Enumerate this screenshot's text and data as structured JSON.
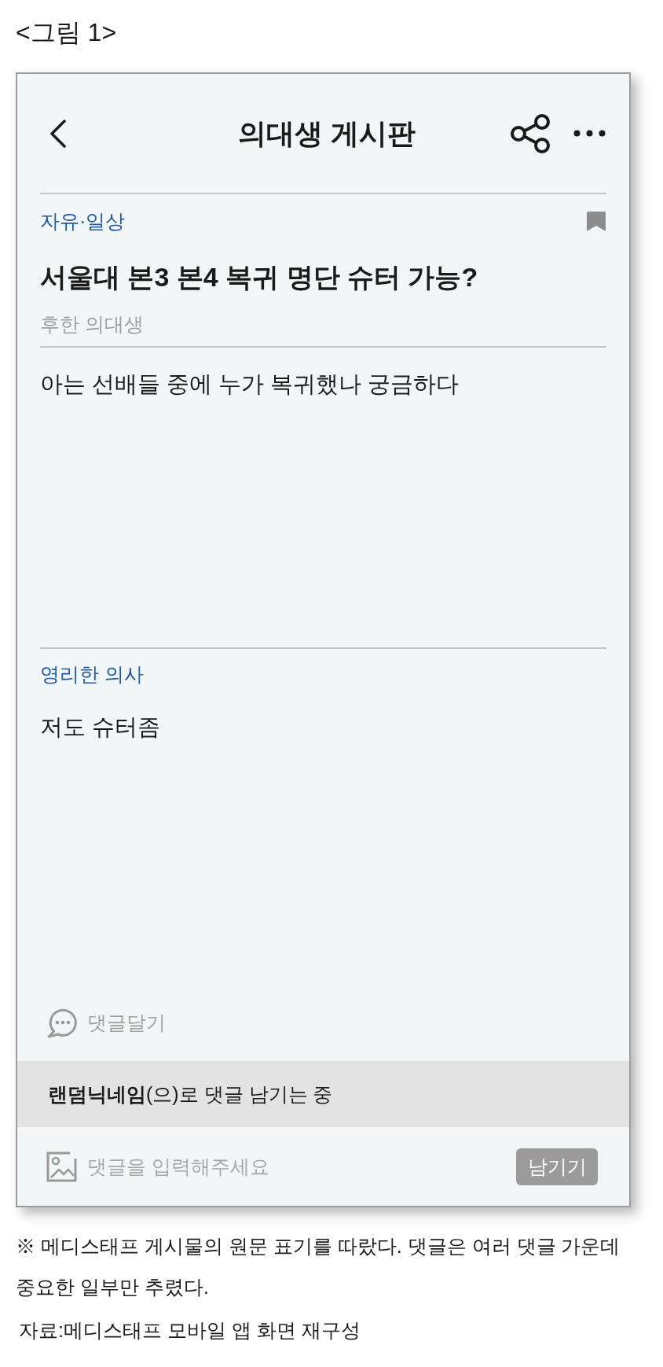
{
  "figure_label": "<그림 1>",
  "app": {
    "header": {
      "title": "의대생 게시판"
    },
    "post": {
      "category": "자유·일상",
      "title": "서울대 본3 본4 복귀 명단 슈터 가능?",
      "author": "후한 의대생",
      "body": "아는 선배들 중에 누가 복귀했나 궁금하다"
    },
    "comments": [
      {
        "author": "영리한 의사",
        "text": "저도 슈터좀"
      }
    ],
    "comment_button": {
      "label": "댓글달기"
    },
    "nickname_notice": "**랜덤닉네임**(으)로 댓글 남기는 중",
    "comment_input": {
      "placeholder": "댓글을 입력해주세요",
      "submit": {
        "label": "남기기",
        "disabled": true
      }
    }
  },
  "footnote": "※ 메디스태프 게시물의 원문 표기를 따랐다. 댓글은 여러 댓글 가운데 중요한 일부만 추렸다.",
  "source": "자료:메디스태프 모바일 앱 화면 재구성"
}
